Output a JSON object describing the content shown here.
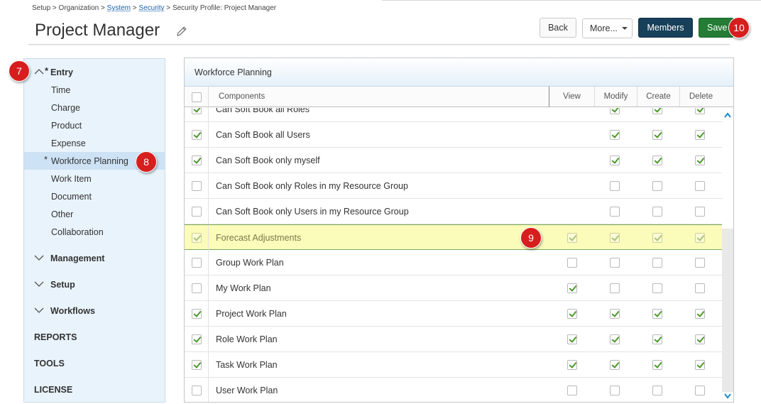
{
  "breadcrumb": {
    "setup": "Setup",
    "sep1": " > ",
    "organization": "Organization",
    "sep2": " > ",
    "system": "System",
    "sep3": " > ",
    "security": "Security",
    "sep4": " > ",
    "current": "Security Profile: Project Manager"
  },
  "page": {
    "title": "Project Manager"
  },
  "toolbar": {
    "back": "Back",
    "more": "More...",
    "members": "Members",
    "save": "Save"
  },
  "badges": {
    "b7": "7",
    "b8": "8",
    "b9": "9",
    "b10": "10"
  },
  "sidebar": {
    "entry": {
      "star": "*",
      "label": "Entry"
    },
    "entry_items": [
      "Time",
      "Charge",
      "Product",
      "Expense",
      "Workforce Planning",
      "Work Item",
      "Document",
      "Other",
      "Collaboration"
    ],
    "selected_star": "*",
    "groups": [
      "Management",
      "Setup",
      "Workflows"
    ],
    "top_items": [
      "REPORTS",
      "TOOLS",
      "LICENSE"
    ]
  },
  "panel": {
    "title": "Workforce Planning",
    "columns": {
      "components": "Components",
      "view": "View",
      "modify": "Modify",
      "create": "Create",
      "delete": "Delete"
    }
  },
  "rows": [
    {
      "name": "Can Soft Book all Roles",
      "sel": true,
      "view": null,
      "modify": true,
      "create": true,
      "delete": true
    },
    {
      "name": "Can Soft Book all Users",
      "sel": true,
      "view": null,
      "modify": true,
      "create": true,
      "delete": true
    },
    {
      "name": "Can Soft Book only myself",
      "sel": true,
      "view": null,
      "modify": true,
      "create": true,
      "delete": true
    },
    {
      "name": "Can Soft Book only Roles in my Resource Group",
      "sel": false,
      "view": null,
      "modify": false,
      "create": false,
      "delete": false
    },
    {
      "name": "Can Soft Book only Users in my Resource Group",
      "sel": false,
      "view": null,
      "modify": false,
      "create": false,
      "delete": false
    },
    {
      "name": "Forecast Adjustments",
      "sel": true,
      "view": true,
      "modify": true,
      "create": true,
      "delete": true,
      "highlight": true
    },
    {
      "name": "Group Work Plan",
      "sel": false,
      "view": false,
      "modify": false,
      "create": false,
      "delete": false
    },
    {
      "name": "My Work Plan",
      "sel": false,
      "view": true,
      "modify": false,
      "create": false,
      "delete": false
    },
    {
      "name": "Project Work Plan",
      "sel": true,
      "view": true,
      "modify": true,
      "create": true,
      "delete": true
    },
    {
      "name": "Role Work Plan",
      "sel": true,
      "view": true,
      "modify": true,
      "create": true,
      "delete": true
    },
    {
      "name": "Task Work Plan",
      "sel": true,
      "view": true,
      "modify": true,
      "create": true,
      "delete": true
    },
    {
      "name": "User Work Plan",
      "sel": false,
      "view": false,
      "modify": false,
      "create": false,
      "delete": false
    }
  ],
  "colors": {
    "members": "#17405a",
    "save": "#247c35",
    "badge": "#d71e1e",
    "check": "#4a9a2a",
    "highlight": "#fbfbba"
  },
  "icons": {
    "edit": "pencil-icon",
    "expand": "chevron-down-icon",
    "collapse": "chevron-up-icon",
    "scroll_up": "arrow-up-icon",
    "scroll_down": "arrow-down-icon"
  }
}
